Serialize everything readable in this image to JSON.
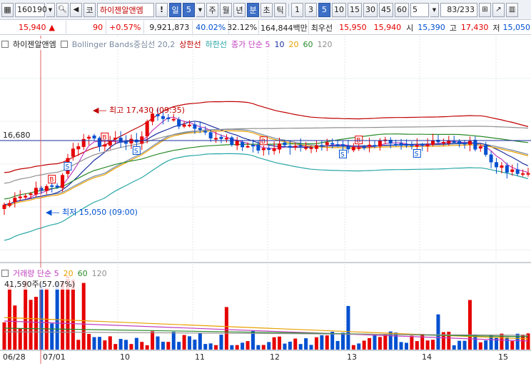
{
  "toolbar": {
    "code": "160190",
    "search_icon": "magnifier-icon",
    "sound_icon": "speaker-icon",
    "market_label": "코",
    "stock_name": "하이젠알앤엠",
    "alert_label": "!",
    "period_label": "일",
    "period_value": "5",
    "periods": [
      "주",
      "월",
      "년",
      "분",
      "초",
      "틱"
    ],
    "active_period": "분",
    "intervals": [
      "1",
      "3",
      "5",
      "10",
      "15",
      "30",
      "45",
      "60"
    ],
    "active_interval": "5",
    "interval_select": "5",
    "count": "83",
    "total": "/233"
  },
  "info": {
    "price": "15,940",
    "change": "90",
    "change_pct": "+0.57%",
    "volume": "9,921,873",
    "vol_ratio": "40.02%",
    "turnover": "32.12%",
    "amount": "164,844백만",
    "high_label": "최우선",
    "best_ask": "15,950",
    "best_bid": "15,940",
    "open_label": "시",
    "open": "15,390",
    "high_label2": "고",
    "high": "17,430",
    "low_label": "저",
    "low": "15,050"
  },
  "price_legend": {
    "stock_name": "하이젠알앤엠",
    "bb_label": "Bollinger Bands중심선 20,2",
    "upper_label": "상한선",
    "lower_label": "하한선",
    "ma_label": "종가 단순 5",
    "ma_periods": [
      "10",
      "20",
      "60",
      "120"
    ]
  },
  "volume_legend": {
    "label": "거래량 단순 5",
    "ma_periods": [
      "20",
      "60",
      "120"
    ],
    "current": "41,590주(57.07%)"
  },
  "annotations": {
    "high_marker": "최고 17,430 (09:35)",
    "low_marker": "최저 15,050 (09:00)",
    "price_line_label": "16,680"
  },
  "x_axis": [
    "06/28",
    "07/01",
    "10",
    "11",
    "12",
    "13",
    "14",
    "15"
  ],
  "colors": {
    "up": "#e60000",
    "down": "#0050d0",
    "bb_mid": "#7a8aa0",
    "bb_upper": "#c00000",
    "bb_lower": "#2aa6a6",
    "ma5": "#c040c0",
    "ma10": "#1a2fa0",
    "ma20": "#e8a000",
    "ma60": "#2a8a2a",
    "ma120": "#909090"
  }
}
